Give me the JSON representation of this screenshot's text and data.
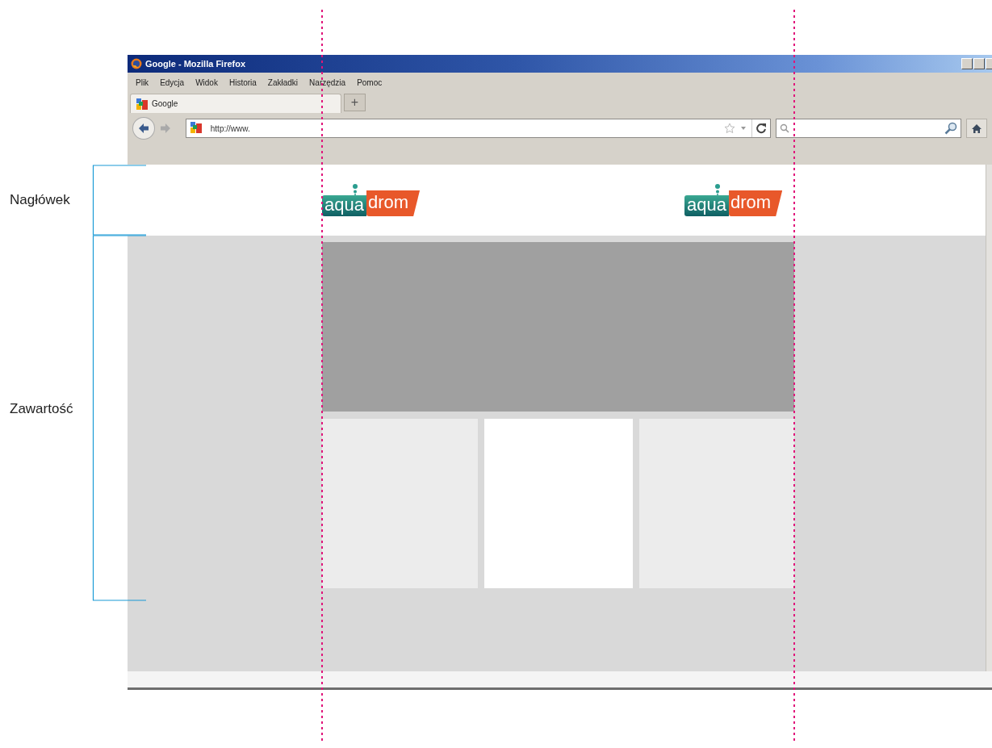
{
  "annotations": {
    "sections": [
      {
        "label": "Nagłówek"
      },
      {
        "label": "Zawartość"
      }
    ]
  },
  "window": {
    "title": "Google - Mozilla Firefox",
    "menu": [
      "Plik",
      "Edycja",
      "Widok",
      "Historia",
      "Zakładki",
      "Narzędzia",
      "Pomoc"
    ],
    "tabs": [
      {
        "label": "Google",
        "selected": true
      }
    ],
    "new_tab": "+",
    "address": {
      "value": "http://www."
    }
  },
  "page": {
    "header": {
      "logos": [
        {
          "left": "aqua",
          "right": "drom"
        },
        {
          "left": "aqua",
          "right": "drom"
        }
      ]
    },
    "content": {
      "tiles": [
        {
          "color": "#ececec"
        },
        {
          "color": "#ffffff"
        },
        {
          "color": "#ececec"
        }
      ]
    }
  }
}
